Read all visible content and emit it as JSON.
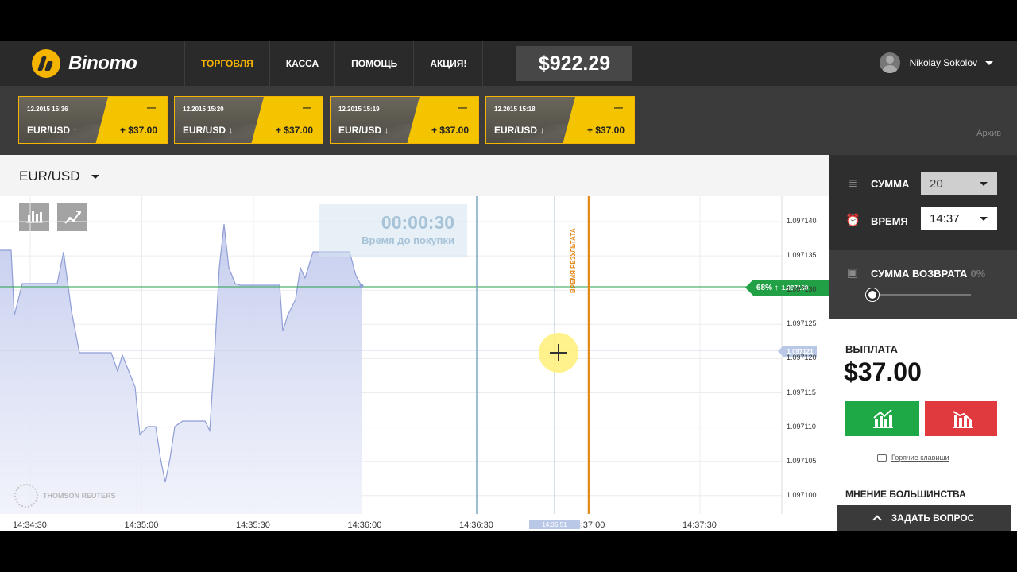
{
  "header": {
    "logo_text": "Binomo",
    "nav": [
      "ТОРГОВЛЯ",
      "КАССА",
      "ПОМОЩЬ",
      "АКЦИЯ!"
    ],
    "balance": "$922.29",
    "user_name": "Nikolay Sokolov"
  },
  "deals": {
    "items": [
      {
        "date": "12.2015 15:36",
        "pair": "EUR/USD ↑",
        "dash": "—",
        "amount": "+ $37.00"
      },
      {
        "date": "12.2015 15:20",
        "pair": "EUR/USD ↓",
        "dash": "—",
        "amount": "+ $37.00"
      },
      {
        "date": "12.2015 15:19",
        "pair": "EUR/USD ↓",
        "dash": "—",
        "amount": "+ $37.00"
      },
      {
        "date": "12.2015 15:18",
        "pair": "EUR/USD ↓",
        "dash": "—",
        "amount": "+ $37.00"
      }
    ],
    "archive": "Архив"
  },
  "chart": {
    "asset": "EUR/USD",
    "timer": "00:00:30",
    "timer_label": "Время до покупки",
    "result_label": "ВРЕМЯ РЕЗУЛЬТАТА",
    "watermark": "THOMSON REUTERS",
    "strike_tag": {
      "pct": "68% ↑",
      "price": "1.097130"
    },
    "current_price": "1.097121",
    "current_time": "14:36:51",
    "y_ticks": [
      "1.097140",
      "1.097135",
      "1.097130",
      "1.097125",
      "1.097120",
      "1.097115",
      "1.097110",
      "1.097105",
      "1.097100"
    ],
    "x_ticks": [
      "14:34:30",
      "14:35:00",
      "14:35:30",
      "14:36:00",
      "14:36:30",
      "14:37:00",
      "14:37:30"
    ],
    "colors": {
      "area": "#c5cdee",
      "line": "#8f9ed6",
      "strike": "#22a046",
      "result": "#e38b1d",
      "buy_line": "#7fa6c4"
    }
  },
  "panel": {
    "amount_label": "СУММА",
    "amount_value": "20",
    "time_label": "ВРЕМЯ",
    "time_value": "14:37",
    "refund_label": "СУММА ВОЗВРАТА",
    "refund_pct": "0%",
    "payout_label": "ВЫПЛАТА",
    "payout_value": "$37.00",
    "hotkeys": "Горячие клавиши",
    "majority": "МНЕНИЕ БОЛЬШИНСТВА",
    "ask": "ЗАДАТЬ ВОПРОС"
  }
}
